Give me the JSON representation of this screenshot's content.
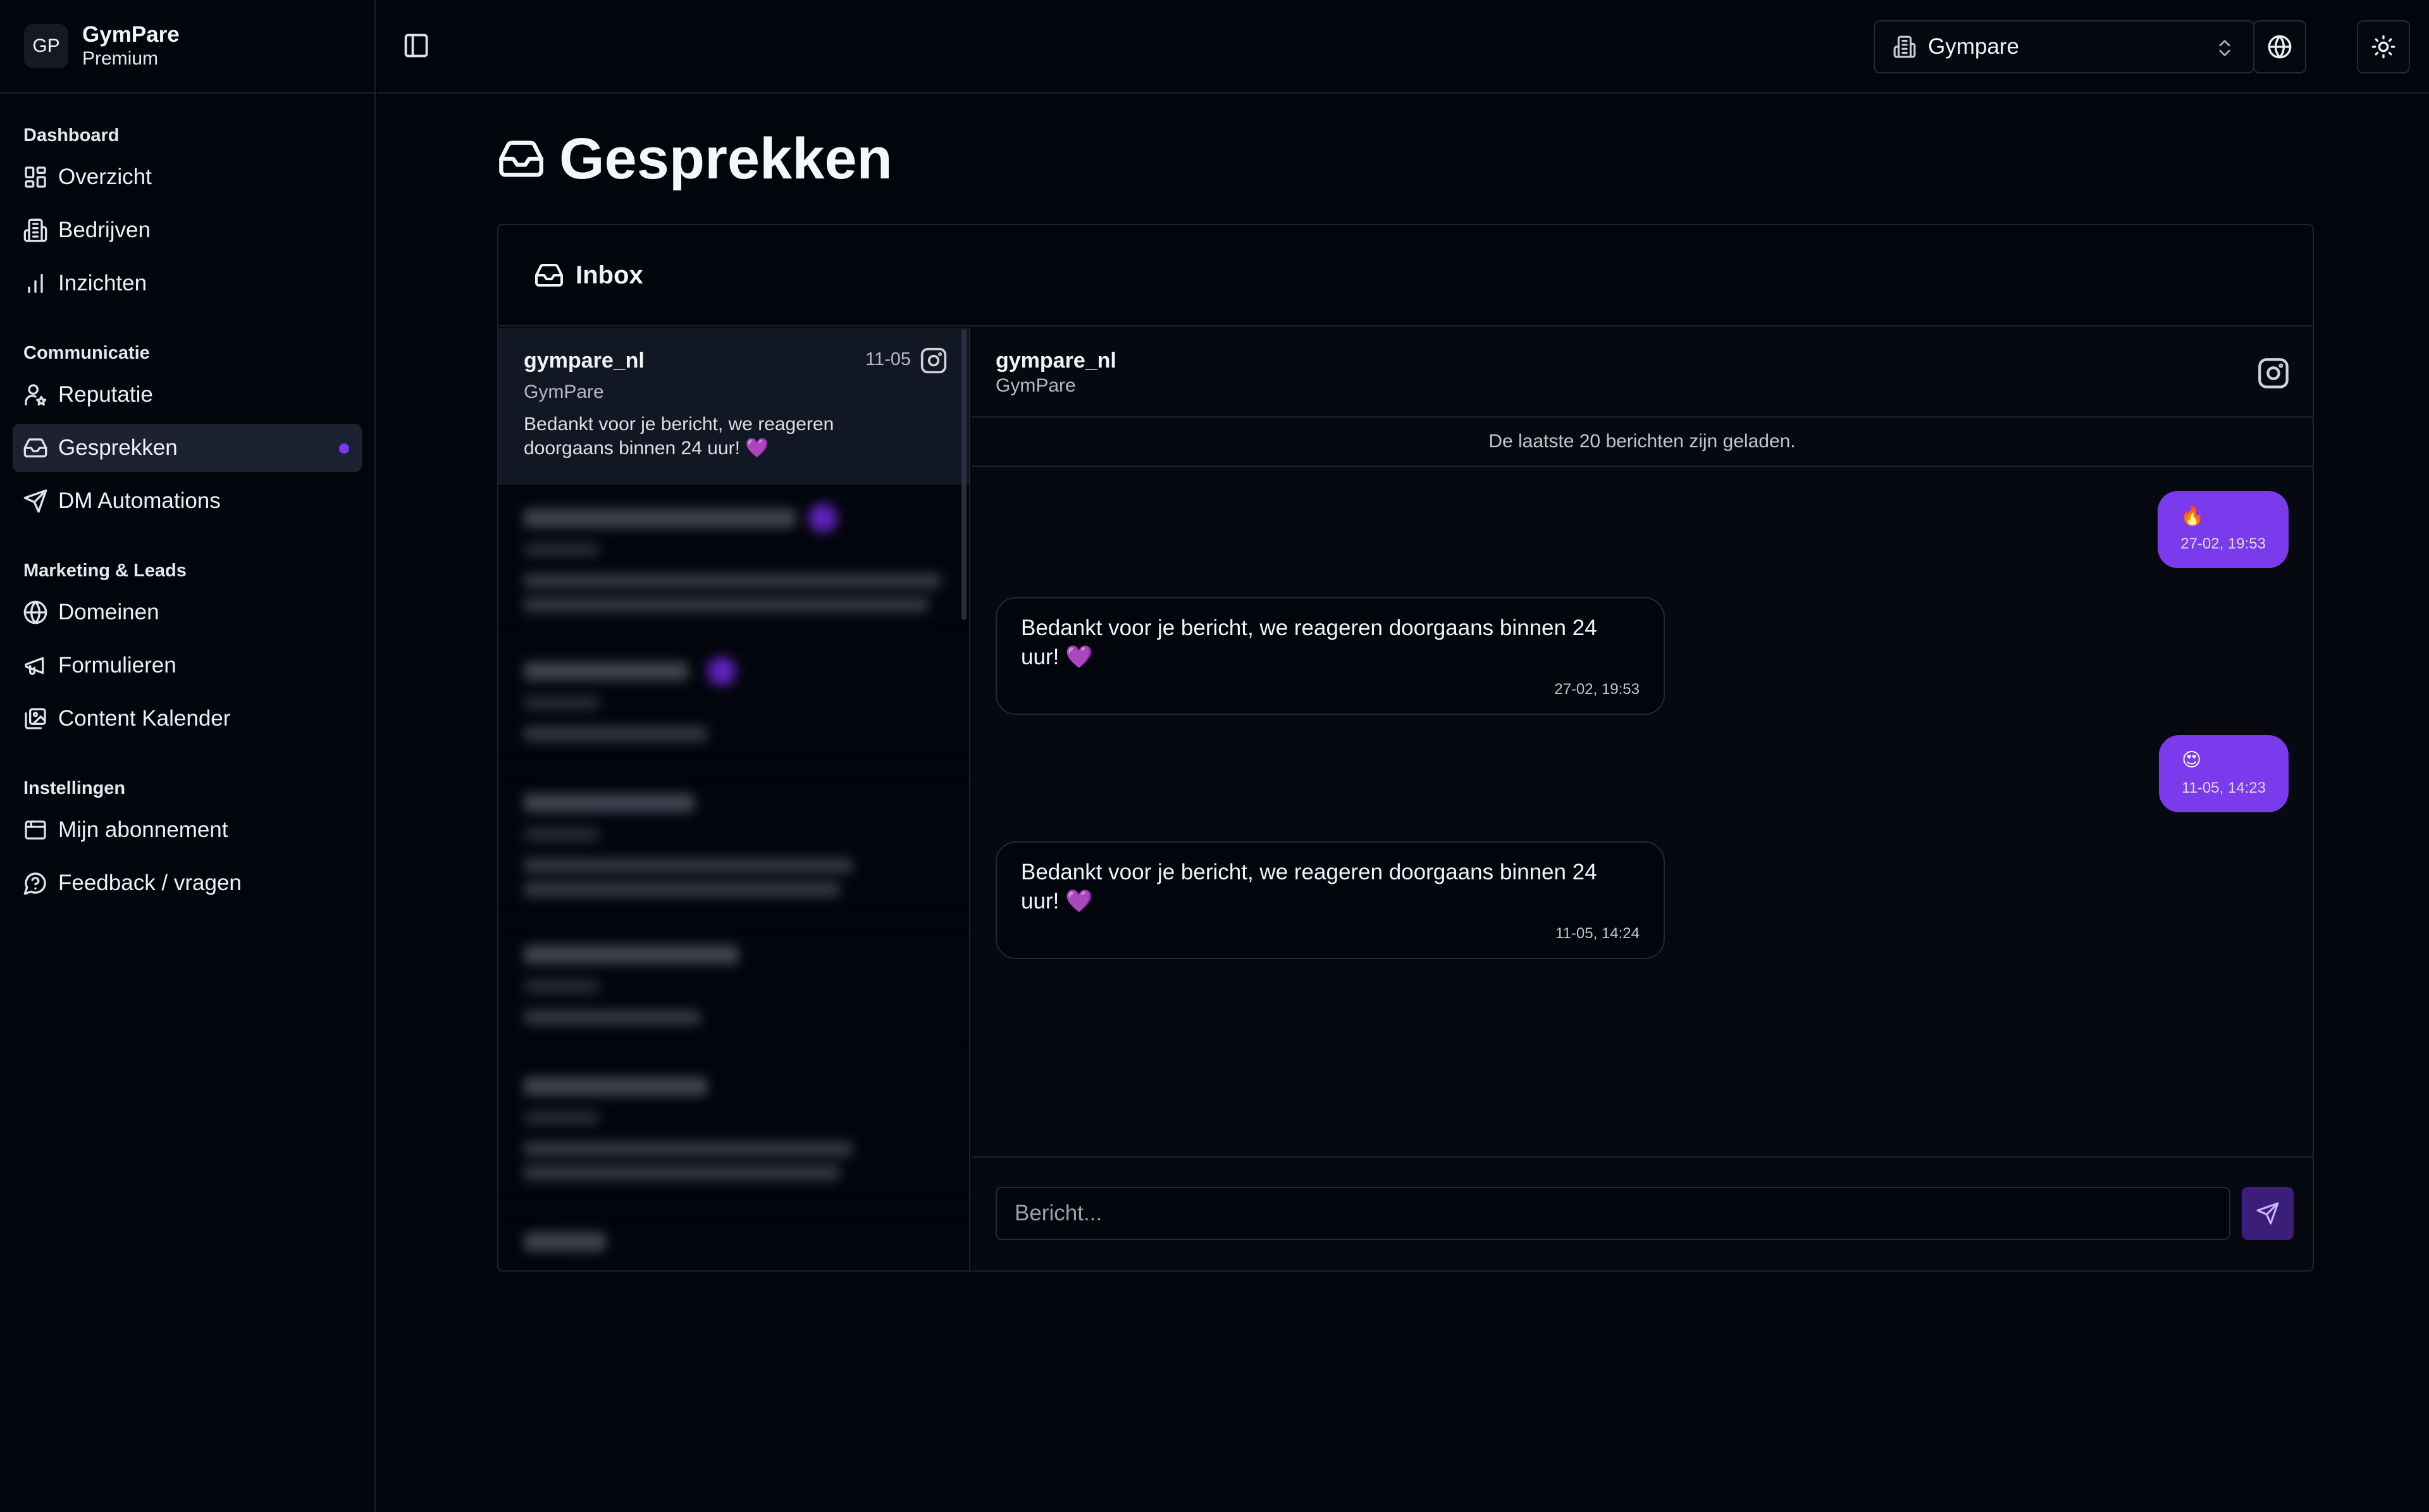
{
  "brand": {
    "logo": "GP",
    "name": "GymPare",
    "plan": "Premium"
  },
  "nav": [
    {
      "title": "Dashboard",
      "items": [
        {
          "label": "Overzicht",
          "icon": "dashboard-icon"
        },
        {
          "label": "Bedrijven",
          "icon": "building-icon"
        },
        {
          "label": "Inzichten",
          "icon": "bar-chart-icon"
        }
      ]
    },
    {
      "title": "Communicatie",
      "items": [
        {
          "label": "Reputatie",
          "icon": "user-star-icon"
        },
        {
          "label": "Gesprekken",
          "icon": "inbox-icon",
          "active": true
        },
        {
          "label": "DM Automations",
          "icon": "send-icon"
        }
      ]
    },
    {
      "title": "Marketing & Leads",
      "items": [
        {
          "label": "Domeinen",
          "icon": "globe-icon"
        },
        {
          "label": "Formulieren",
          "icon": "megaphone-icon"
        },
        {
          "label": "Content Kalender",
          "icon": "images-icon"
        }
      ]
    },
    {
      "title": "Instellingen",
      "items": [
        {
          "label": "Mijn abonnement",
          "icon": "wallet-icon"
        },
        {
          "label": "Feedback / vragen",
          "icon": "help-circle-icon"
        }
      ]
    }
  ],
  "topbar": {
    "org_selected": "Gympare"
  },
  "page": {
    "title": "Gesprekken"
  },
  "inbox": {
    "title": "Inbox",
    "conversations": [
      {
        "name": "gympare_nl",
        "sub": "GymPare",
        "date": "11-05",
        "preview": "Bedankt voor je bericht, we reageren doorgaans binnen 24 uur! 💜"
      }
    ]
  },
  "chat": {
    "name": "gympare_nl",
    "sub": "GymPare",
    "info": "De laatste 20 berichten zijn geladen.",
    "messages": [
      {
        "dir": "out",
        "text": "🔥",
        "time": "27-02, 19:53"
      },
      {
        "dir": "in",
        "text": "Bedankt voor je bericht, we reageren doorgaans binnen 24 uur! 💜",
        "time": "27-02, 19:53"
      },
      {
        "dir": "out",
        "text": "😍",
        "time": "11-05, 14:23"
      },
      {
        "dir": "in",
        "text": "Bedankt voor je bericht, we reageren doorgaans binnen 24 uur! 💜",
        "time": "11-05, 14:24"
      }
    ],
    "composer_placeholder": "Bericht..."
  },
  "colors": {
    "accent": "#7c3aed",
    "background": "#03050c",
    "active_nav": "#1c2232"
  }
}
